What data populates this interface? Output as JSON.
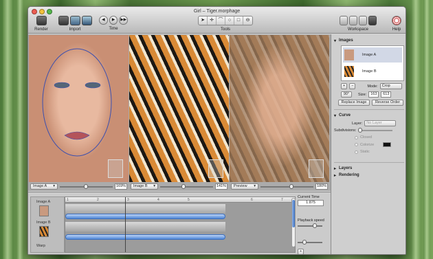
{
  "window": {
    "title": "Girl – Tiger.morphage"
  },
  "toolbar": {
    "render_label": "Render",
    "import_label": "Import",
    "time_label": "Time",
    "tools_label": "Tools",
    "workspace_label": "Workspace",
    "help_label": "Help",
    "time_buttons": [
      "◀",
      "▶",
      "▶▶"
    ],
    "tool_icons": [
      "arrow-tool-icon",
      "point-tool-icon",
      "morph-tool-icon",
      "circle-tool-icon",
      "rect-tool-icon",
      "crop-tool-icon"
    ]
  },
  "viewers": [
    {
      "name": "viewer-image-a",
      "select": "Image A",
      "zoom": "169%"
    },
    {
      "name": "viewer-image-b",
      "select": "Image B",
      "zoom": "141%"
    },
    {
      "name": "viewer-preview",
      "select": "Preview",
      "zoom": "180%"
    }
  ],
  "inspector": {
    "images_heading": "Images",
    "images": [
      "Image A",
      "Image B"
    ],
    "add_label": "+",
    "remove_label": "−",
    "mode_label": "Mode:",
    "mode_value": "Crop",
    "rot_label": "90°",
    "size_label": "Size:",
    "size_w": "163",
    "size_h": "613",
    "replace_label": "Replace Image",
    "reverse_label": "Reverse Order",
    "curve_heading": "Curve",
    "layer_label": "Layer:",
    "layer_value": "No Layer",
    "subdivisions_label": "Subdivisions:",
    "options": [
      "Closed",
      "Colorize",
      "Static"
    ],
    "layers_heading": "Layers",
    "rendering_heading": "Rendering"
  },
  "timeline": {
    "tracks": [
      "Image A",
      "Image B",
      "Warp"
    ],
    "ruler": [
      "1",
      "2",
      "3",
      "4",
      "5",
      "6",
      "7"
    ],
    "current_time_label": "Current Time",
    "current_time": "1.875",
    "playback_label": "Playback speed",
    "add_label": "+"
  },
  "colors": {
    "accent": "#4f86d6"
  }
}
